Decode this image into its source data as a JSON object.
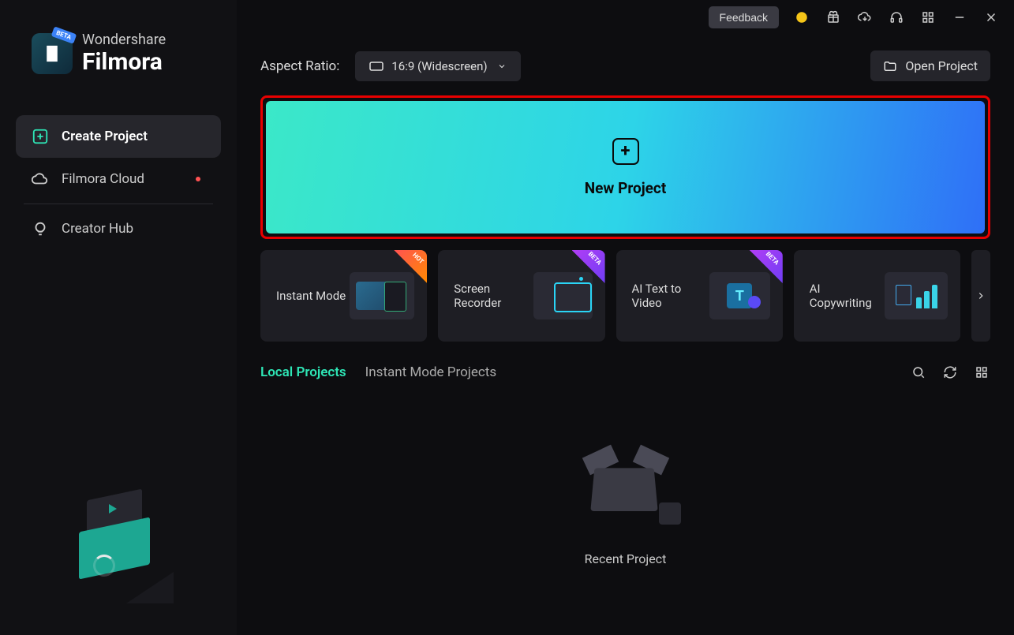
{
  "brand": {
    "company": "Wondershare",
    "product": "Filmora",
    "beta": "BETA"
  },
  "nav": {
    "items": [
      {
        "label": "Create Project"
      },
      {
        "label": "Filmora Cloud"
      },
      {
        "label": "Creator Hub"
      }
    ]
  },
  "titlebar": {
    "feedback": "Feedback"
  },
  "aspect": {
    "label": "Aspect Ratio:",
    "value": "16:9 (Widescreen)"
  },
  "open_project": "Open Project",
  "new_project": "New Project",
  "cards": [
    {
      "title": "Instant Mode",
      "badge": "HOT"
    },
    {
      "title": "Screen Recorder",
      "badge": "BETA"
    },
    {
      "title": "AI Text to Video",
      "badge": "BETA"
    },
    {
      "title": "AI Copywriting",
      "badge": ""
    }
  ],
  "tabs": {
    "local": "Local Projects",
    "instant": "Instant Mode Projects"
  },
  "empty": {
    "label": "Recent Project"
  }
}
